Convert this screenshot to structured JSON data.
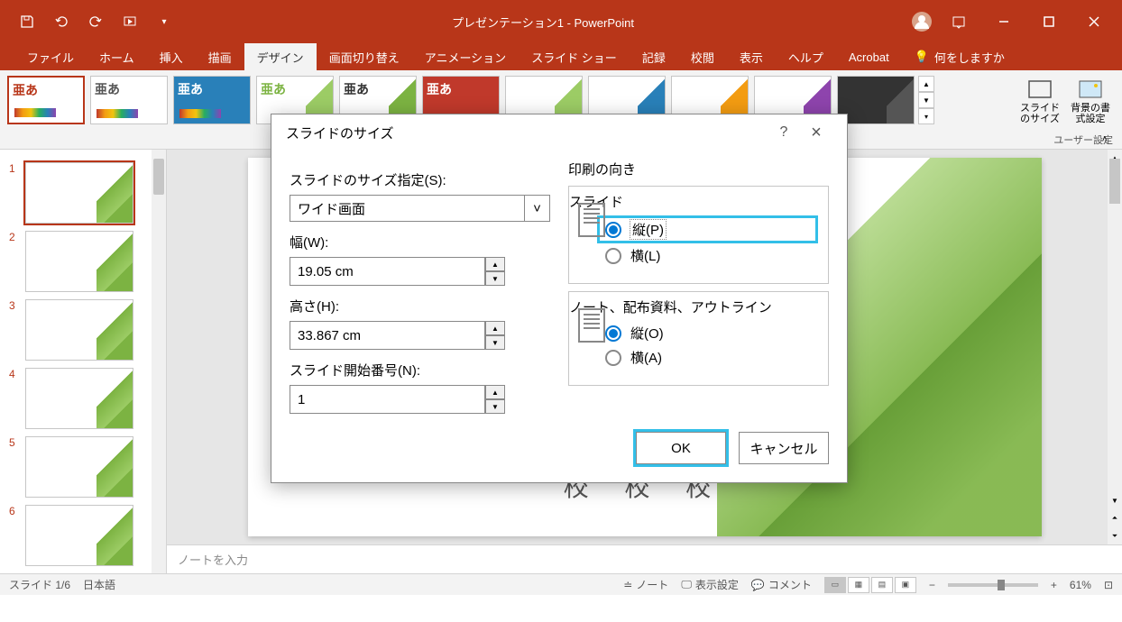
{
  "app": {
    "title": "プレゼンテーション1 - PowerPoint"
  },
  "ribbon": {
    "tabs": [
      "ファイル",
      "ホーム",
      "挿入",
      "描画",
      "デザイン",
      "画面切り替え",
      "アニメーション",
      "スライド ショー",
      "記録",
      "校閲",
      "表示",
      "ヘルプ",
      "Acrobat"
    ],
    "active_tab": "デザイン",
    "tell_me": "何をしますか",
    "theme_sample_text": "亜あ",
    "slide_size_label": "スライドのサイズ",
    "bg_format_label": "背景の書式設定",
    "group_label": "ユーザー設定"
  },
  "slides": {
    "count": 6,
    "selected": 1
  },
  "notes": {
    "placeholder": "ノートを入力"
  },
  "status": {
    "slide_counter": "スライド 1/6",
    "language": "日本語",
    "notes_btn": "ノート",
    "display_settings": "表示設定",
    "comments": "コメント",
    "zoom": "61%"
  },
  "canvas": {
    "sample_text": "校 校 校"
  },
  "dialog": {
    "title": "スライドのサイズ",
    "size_spec_label": "スライドのサイズ指定(S):",
    "size_spec_value": "ワイド画面",
    "width_label": "幅(W):",
    "width_value": "19.05 cm",
    "height_label": "高さ(H):",
    "height_value": "33.867 cm",
    "start_num_label": "スライド開始番号(N):",
    "start_num_value": "1",
    "orientation_title": "印刷の向き",
    "slide_section": "スライド",
    "portrait_label": "縦(P)",
    "landscape_label": "横(L)",
    "notes_section": "ノート、配布資料、アウトライン",
    "portrait_o_label": "縦(O)",
    "landscape_a_label": "横(A)",
    "ok": "OK",
    "cancel": "キャンセル",
    "help": "?",
    "close": "×"
  }
}
